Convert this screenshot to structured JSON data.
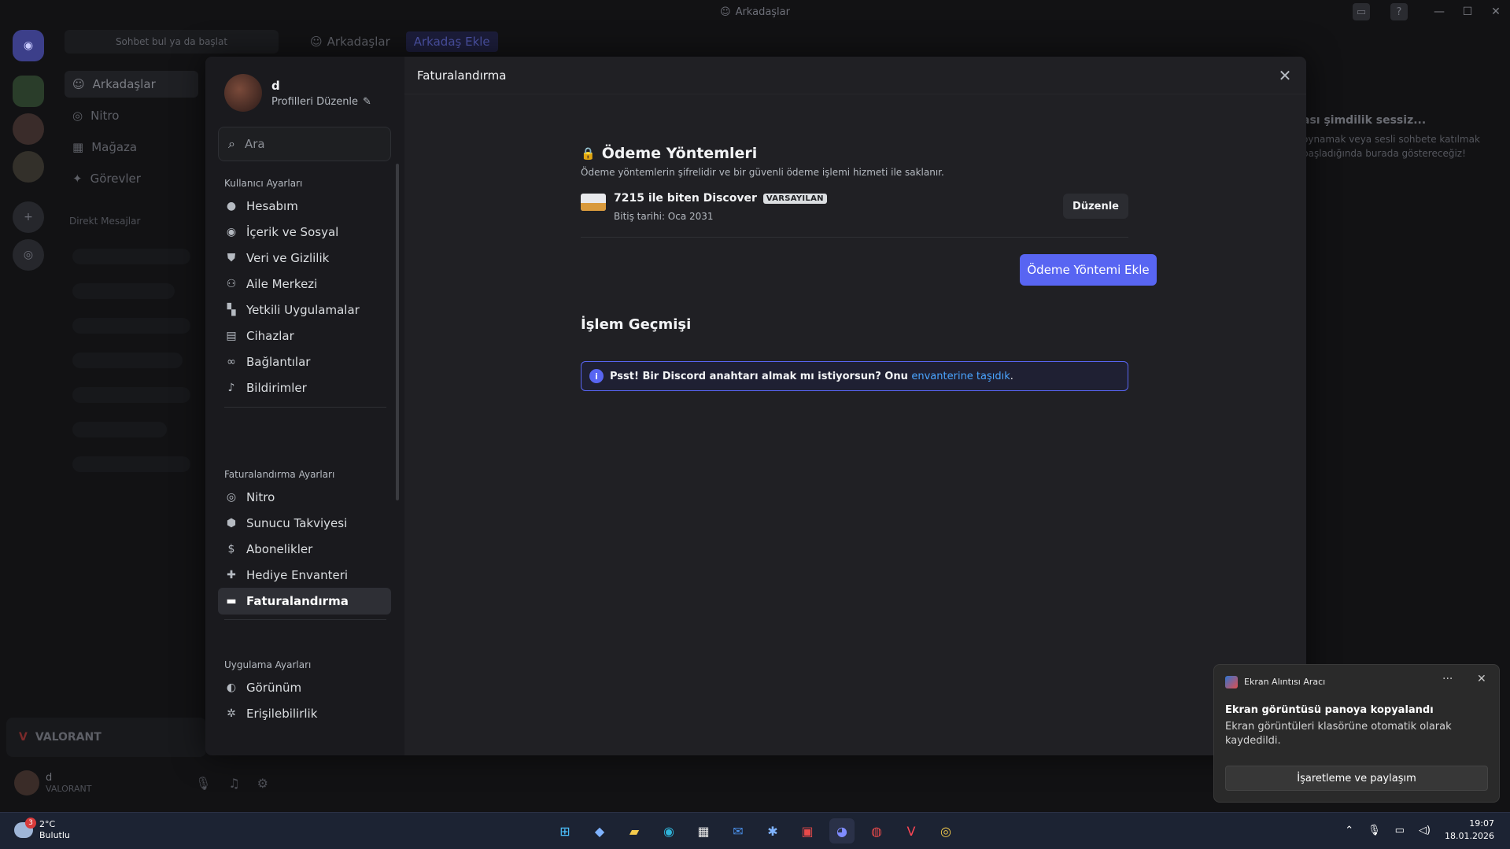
{
  "window": {
    "title": "Arkadaşlar"
  },
  "channels": {
    "search_placeholder": "Sohbet bul ya da başlat",
    "items": [
      {
        "label": "Arkadaşlar"
      },
      {
        "label": "Nitro"
      },
      {
        "label": "Mağaza"
      },
      {
        "label": "Görevler"
      }
    ],
    "dm_label": "Direkt Mesajlar"
  },
  "topnav": {
    "friends": "Arkadaşlar",
    "add_friend": "Arkadaş Ekle"
  },
  "activity": {
    "title": "ası şimdilik sessiz...",
    "text": "oynamak veya sesli sohbete katılmak başladığında burada göstereceğiz!"
  },
  "game_bar": {
    "label": "VALORANT"
  },
  "user_panel": {
    "name": "d",
    "status": "VALORANT"
  },
  "settings": {
    "profile": {
      "name": "d",
      "edit": "Profilleri Düzenle"
    },
    "search_placeholder": "Ara",
    "sections": {
      "user": "Kullanıcı Ayarları",
      "billing": "Faturalandırma Ayarları",
      "app": "Uygulama Ayarları"
    },
    "user_items": [
      {
        "label": "Hesabım"
      },
      {
        "label": "İçerik ve Sosyal"
      },
      {
        "label": "Veri ve Gizlilik"
      },
      {
        "label": "Aile Merkezi"
      },
      {
        "label": "Yetkili Uygulamalar"
      },
      {
        "label": "Cihazlar"
      },
      {
        "label": "Bağlantılar"
      },
      {
        "label": "Bildirimler"
      }
    ],
    "billing_items": [
      {
        "label": "Nitro"
      },
      {
        "label": "Sunucu Takviyesi"
      },
      {
        "label": "Abonelikler"
      },
      {
        "label": "Hediye Envanteri"
      },
      {
        "label": "Faturalandırma"
      }
    ],
    "app_items": [
      {
        "label": "Görünüm"
      },
      {
        "label": "Erişilebilirlik"
      }
    ]
  },
  "billing": {
    "header": "Faturalandırma",
    "payment_title": "Ödeme Yöntemleri",
    "payment_desc": "Ödeme yöntemlerin şifrelidir ve bir güvenli ödeme işlemi hizmeti ile saklanır.",
    "card_name": "7215 ile biten Discover",
    "card_badge": "VARSAYILAN",
    "card_expiry": "Bitiş tarihi: Oca 2031",
    "edit_button": "Düzenle",
    "add_button": "Ödeme Yöntemi Ekle",
    "history_title": "İşlem Geçmişi",
    "notice_text": "Psst! Bir Discord anahtarı almak mı istiyorsun? Onu ",
    "notice_link": "envanterine taşıdık",
    "notice_end": "."
  },
  "toast": {
    "app_name": "Ekran Alıntısı Aracı",
    "title": "Ekran görüntüsü panoya kopyalandı",
    "body": "Ekran görüntüleri klasörüne otomatik olarak kaydedildi.",
    "button": "İşaretleme ve paylaşım"
  },
  "taskbar": {
    "weather_temp": "2°C",
    "weather_desc": "Bulutlu",
    "weather_count": "3",
    "time": "19:07",
    "date": "18.01.2026"
  }
}
